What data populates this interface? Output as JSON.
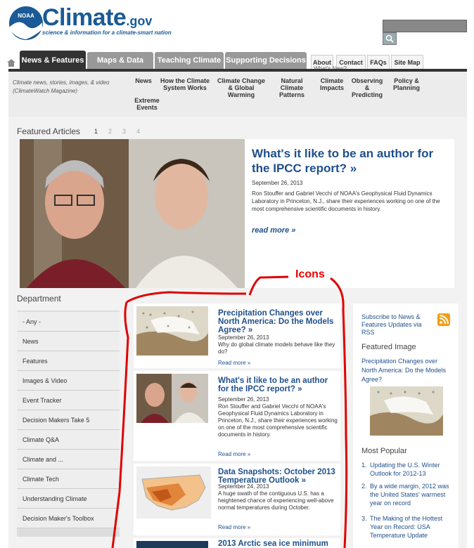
{
  "header": {
    "brand": "Climate",
    "brand_suffix": ".gov",
    "noaa": "NOAA",
    "tagline": "science & information for a climate-smart nation"
  },
  "nav": {
    "tabs": [
      "News & Features",
      "Maps & Data",
      "Teaching Climate",
      "Supporting Decisions"
    ],
    "utility": [
      "About",
      "Contact",
      "FAQs",
      "Site Map"
    ],
    "whats_new": "What's New?"
  },
  "subnav": {
    "description": "Climate news, stories, images, & video (ClimateWatch Magazine)",
    "items": [
      "News",
      "Extreme Events",
      "How the Climate System Works",
      "Climate Change & Global Warming",
      "Natural Climate Patterns",
      "Climate Impacts",
      "Observing & Predicting",
      "Policy & Planning"
    ]
  },
  "featured": {
    "label": "Featured Articles",
    "pages": [
      "1",
      "2",
      "3",
      "4"
    ],
    "title": "What's it like to be an author for the IPCC report? »",
    "date": "September 26, 2013",
    "body": "Ron Stouffer and Gabriel Vecchi of NOAA's Geophysical Fluid Dynamics Laboratory in Princeton, N.J., share their experiences working on one of the most comprehensive scientific documents in history.",
    "more": "read more »"
  },
  "department": {
    "title": "Department",
    "items": [
      "- Any -",
      "News",
      "Features",
      "Images & Video",
      "Event Tracker",
      "Decision Makers Take 5",
      "Climate Q&A",
      "Climate and ...",
      "Climate Tech",
      "Understanding Climate",
      "Decision Maker's Toolbox"
    ]
  },
  "articles": [
    {
      "title": "Precipitation Changes over North America: Do the Models Agree? »",
      "date": "September 26, 2013",
      "body": "Why do global climate models behave like they do?",
      "more": "Read more »"
    },
    {
      "title": "What's it like to be an author for the IPCC report? »",
      "date": "September 26, 2013",
      "body": "Ron Stouffer and Gabriel Vecchi of NOAA's Geophysical Fluid Dynamics Laboratory in Princeton, N.J., share their experiences working on one of the most comprehensive scientific documents in history.",
      "more": "Read more »"
    },
    {
      "title": "Data Snapshots: October 2013 Temperature Outlook »",
      "date": "September 24, 2013",
      "body": "A huge swath of the contiguous U.S. has a heightened chance of experiencing well-above normal temperatures during October.",
      "more": "Read more »"
    },
    {
      "title": "2013 Arctic sea ice minimum"
    }
  ],
  "sidebar": {
    "rss": "Subscribe to News & Features Updates via RSS",
    "featured_image_title": "Featured Image",
    "featured_image_link": "Precipitation Changes over North America: Do the Models Agree?",
    "most_popular_title": "Most Popular",
    "most_popular": [
      {
        "n": "1.",
        "t": "Updating the U.S. Winter Outlook for 2012-13"
      },
      {
        "n": "2.",
        "t": "By a wide margin, 2012 was the United States' warmest year on record"
      },
      {
        "n": "3.",
        "t": "The Making of the Hottest Year on Record: USA Temperature Update"
      }
    ]
  },
  "annotation": {
    "label": "Icons",
    "color": "#e00000"
  },
  "colors": {
    "link": "#1e4f8c",
    "nav_active": "#333333",
    "nav_inactive": "#999999"
  }
}
